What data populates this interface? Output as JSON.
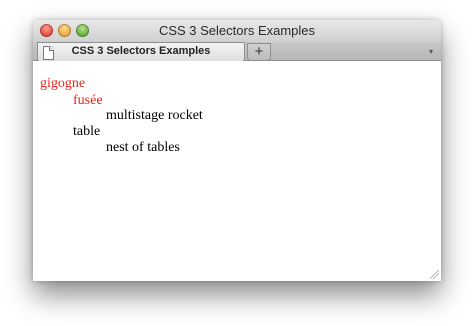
{
  "window": {
    "title": "CSS 3 Selectors Examples"
  },
  "tabs": {
    "active_label": "CSS 3 Selectors Examples",
    "new_tab_label": "+",
    "menu_glyph": "▾"
  },
  "content": {
    "lines": [
      {
        "text": "gigogne",
        "color": "#e8241b"
      },
      {
        "text": "fusée",
        "color": "#e8241b"
      },
      {
        "text": "multistage rocket",
        "color": "#000000"
      },
      {
        "text": "table",
        "color": "#000000"
      },
      {
        "text": "nest of tables",
        "color": "#000000"
      }
    ]
  }
}
